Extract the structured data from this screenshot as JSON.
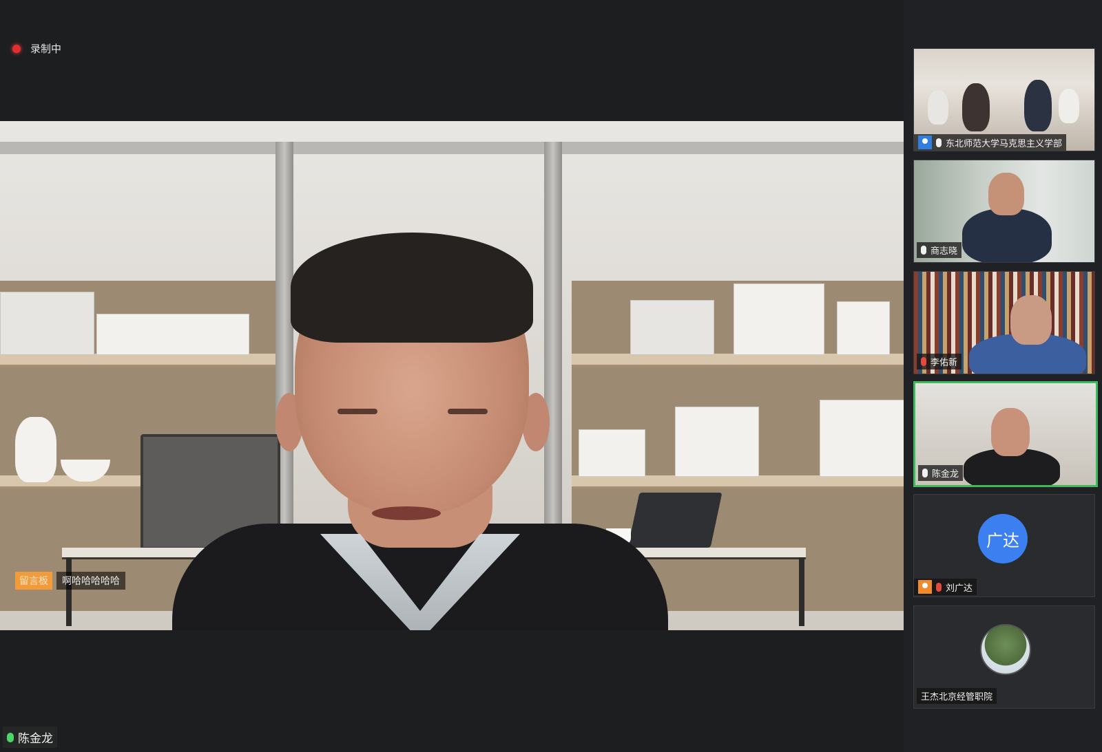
{
  "recording": {
    "label": "录制中"
  },
  "main_video": {
    "speaker_name": "陈金龙",
    "overlay_tag": "留言板",
    "overlay_text": "啊哈哈哈哈哈"
  },
  "participants": [
    {
      "name": "东北师范大学马克思主义学部",
      "mic": "on",
      "has_person_icon": true,
      "view": "classroom-video"
    },
    {
      "name": "商志晓",
      "mic": "on",
      "view": "office-video"
    },
    {
      "name": "李佑新",
      "mic": "muted",
      "view": "bookshelf-video"
    },
    {
      "name": "陈金龙",
      "mic": "on",
      "active_speaker": true,
      "view": "self-video"
    },
    {
      "name": "刘广达",
      "mic": "muted",
      "avatar_initials": "广达",
      "view": "avatar"
    },
    {
      "name": "王杰北京经管职院",
      "view": "photo-avatar"
    }
  ],
  "colors": {
    "active_border": "#3fb95a",
    "record_dot": "#e02f2f",
    "avatar_blue": "#3b7ff0",
    "muted_mic": "#e34a3c"
  }
}
